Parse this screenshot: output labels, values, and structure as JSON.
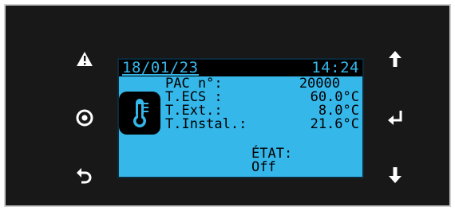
{
  "screen": {
    "date": "18/01/23",
    "time": "14:24",
    "rows": [
      {
        "label": "PAC n°:",
        "value": "20000"
      },
      {
        "label": "T.ECS :",
        "value": "60.0°C"
      },
      {
        "label": "T.Ext.:",
        "value": "8.0°C"
      },
      {
        "label": "T.Instal.:",
        "value": "21.6°C"
      }
    ],
    "etat_label": "ÉTAT:",
    "etat_value": "Off"
  },
  "icons": {
    "left": [
      "warning-icon",
      "target-icon",
      "back-icon"
    ],
    "right": [
      "arrow-up-icon",
      "enter-icon",
      "arrow-down-icon"
    ],
    "screen": "thermometer-icon"
  },
  "colors": {
    "screen_bg": "#35b7ea",
    "panel_bg": "#181818",
    "text": "#000000",
    "button": "#ffffff"
  }
}
